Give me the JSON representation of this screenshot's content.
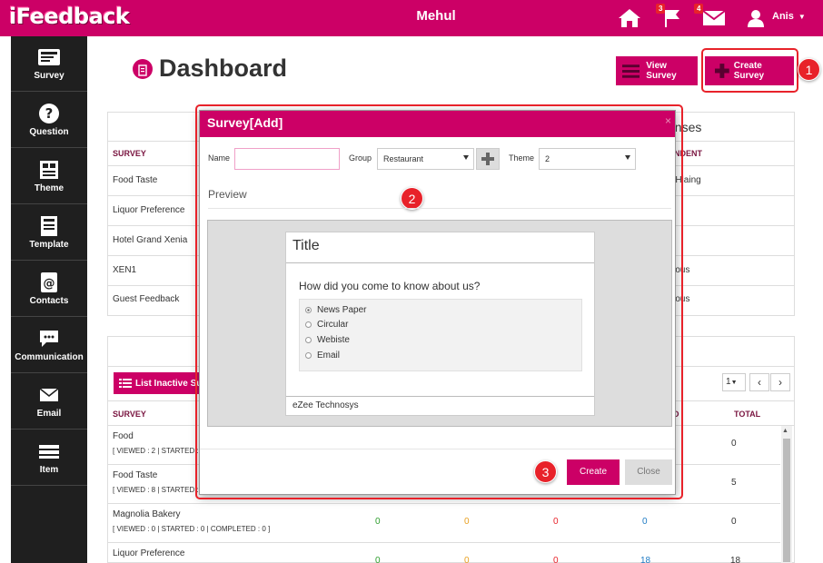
{
  "app": {
    "logo": "iFeedback",
    "company": "Mehul"
  },
  "topbar": {
    "flag_count": "3",
    "mail_count": "4",
    "user_name": "Anis"
  },
  "sidebar": {
    "items": [
      {
        "label": "Survey",
        "icon": "survey-icon"
      },
      {
        "label": "Question",
        "icon": "question-icon"
      },
      {
        "label": "Theme",
        "icon": "theme-icon"
      },
      {
        "label": "Template",
        "icon": "template-icon"
      },
      {
        "label": "Contacts",
        "icon": "contacts-icon"
      },
      {
        "label": "Communication",
        "icon": "communication-icon"
      },
      {
        "label": "Email",
        "icon": "email-icon"
      },
      {
        "label": "Item",
        "icon": "item-icon"
      }
    ]
  },
  "page": {
    "title": "Dashboard",
    "view_survey": "View Survey",
    "create_survey": "Create Survey"
  },
  "callouts": {
    "one": "1",
    "two": "2",
    "three": "3"
  },
  "top_table": {
    "partial_header": "onses",
    "col_survey": "SURVEY",
    "col_respondent": "ONDENT",
    "rows": [
      {
        "survey": "Food Taste",
        "respondent": "e Hlaing"
      },
      {
        "survey": "Liquor Preference",
        "respondent": ""
      },
      {
        "survey": "Hotel Grand Xenia",
        "respondent": ""
      },
      {
        "survey": "XEN1",
        "respondent": "mous"
      },
      {
        "survey": "Guest Feedback",
        "respondent": "mous"
      }
    ]
  },
  "bottom_table": {
    "list_inactive": "List Inactive Su",
    "pager_value": "1",
    "col_survey": "SURVEY",
    "col_ed": "ED",
    "col_total": "TOTAL",
    "rows": [
      {
        "name": "Food",
        "sub": "[ VIEWED : 2 | STARTED : 0",
        "c1": "",
        "c2": "",
        "c3": "",
        "c4": "",
        "total": "0"
      },
      {
        "name": "Food Taste",
        "sub": "[ VIEWED : 8 | STARTED : 6",
        "c1": "",
        "c2": "",
        "c3": "",
        "c4": "",
        "total": "5"
      },
      {
        "name": "Magnolia Bakery",
        "sub": "[ VIEWED : 0 | STARTED : 0 | COMPLETED : 0 ]",
        "c1": "0",
        "c2": "0",
        "c3": "0",
        "c4": "0",
        "total": "0"
      },
      {
        "name": "Liquor Preference",
        "sub": "",
        "c1": "0",
        "c2": "0",
        "c3": "0",
        "c4": "18",
        "total": "18"
      }
    ]
  },
  "modal": {
    "title": "Survey[Add]",
    "close": "×",
    "name_label": "Name",
    "name_value": "",
    "group_label": "Group",
    "group_value": "Restaurant",
    "theme_label": "Theme",
    "theme_value": "2",
    "preview_label": "Preview",
    "card_title": "Title",
    "question": "How did you come to know about us?",
    "options": [
      "News Paper",
      "Circular",
      "Webiste",
      "Email"
    ],
    "selected_option": 0,
    "footer": "eZee Technosys",
    "create": "Create",
    "close_btn": "Close"
  },
  "colors": {
    "brand": "#cc0066",
    "sidebar": "#1f1f1f",
    "callout": "#e8222a",
    "green": "#2e9e2e",
    "orange": "#e8a020",
    "red": "#e8222a",
    "blue": "#1f7bc4"
  }
}
